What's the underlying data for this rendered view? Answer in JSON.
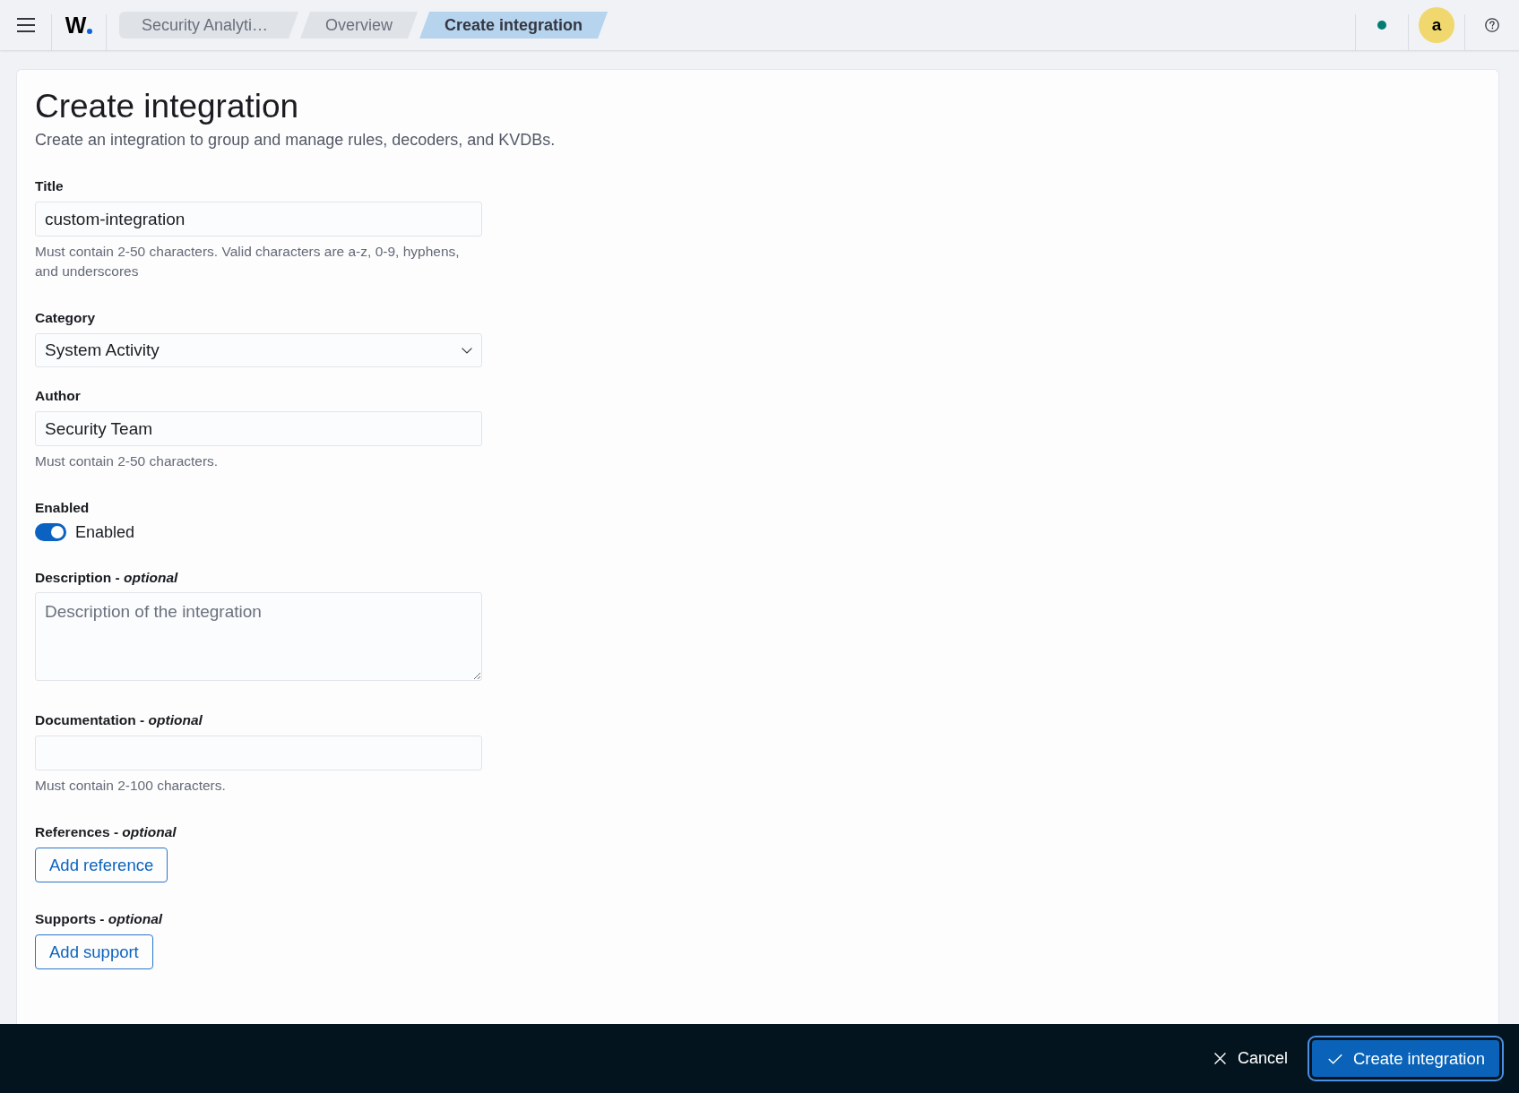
{
  "header": {
    "logo": "W",
    "breadcrumbs": [
      {
        "label": "Security Analyti…",
        "selected": false
      },
      {
        "label": "Overview",
        "selected": false
      },
      {
        "label": "Create integration",
        "selected": true
      }
    ],
    "avatar": "a"
  },
  "page": {
    "title": "Create integration",
    "description": "Create an integration to group and manage rules, decoders, and KVDBs."
  },
  "form": {
    "fields": [
      {
        "kind": "text",
        "label": "Title",
        "value": "custom-integration",
        "help": "Must contain 2-50 characters. Valid characters are a-z, 0-9, hyphens, and underscores"
      },
      {
        "kind": "select",
        "label": "Category",
        "value": "System Activity"
      },
      {
        "kind": "text",
        "label": "Author",
        "value": "Security Team",
        "help": "Must contain 2-50 characters."
      },
      {
        "kind": "switch",
        "label": "Enabled",
        "on": true,
        "switch_label": "Enabled"
      },
      {
        "kind": "textarea",
        "label": "Description - *optional*",
        "placeholder": "Description of the integration"
      },
      {
        "kind": "text",
        "label": "Documentation - *optional*",
        "help": "Must contain 2-100 characters."
      },
      {
        "kind": "button",
        "label": "References - *optional*",
        "button": "Add reference"
      },
      {
        "kind": "button",
        "label": "Supports - *optional*",
        "button": "Add support"
      }
    ]
  },
  "footer": {
    "cancel": "Cancel",
    "submit": "Create integration"
  }
}
